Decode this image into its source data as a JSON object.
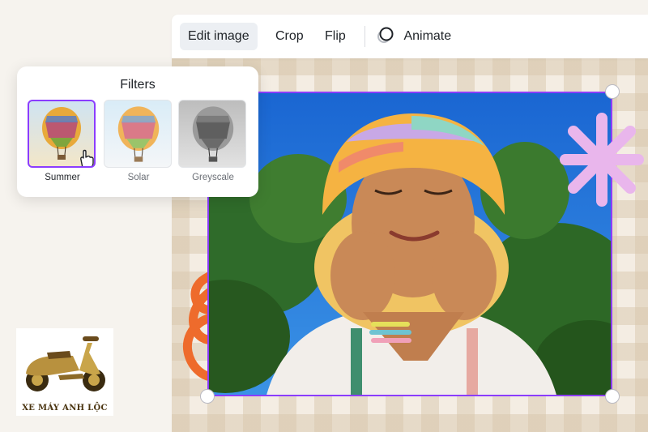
{
  "toolbar": {
    "edit_image_label": "Edit image",
    "crop_label": "Crop",
    "flip_label": "Flip",
    "animate_label": "Animate",
    "active_item": "Edit image"
  },
  "filters": {
    "title": "Filters",
    "items": [
      {
        "label": "Summer",
        "selected": true
      },
      {
        "label": "Solar",
        "selected": false
      },
      {
        "label": "Greyscale",
        "selected": false
      }
    ]
  },
  "logo": {
    "text": "XE MÁY ANH LỘC"
  },
  "colors": {
    "selection": "#8b3dff",
    "sky": "#2b83e8",
    "swirl": "#ee6b2c",
    "star": "#e9b6ec",
    "canvas": "#f4ede3"
  },
  "icons": [
    "animate-icon",
    "pointer-hand-icon",
    "hot-air-balloon-icon",
    "scooter-icon",
    "swirl-sticker",
    "star-sticker"
  ]
}
